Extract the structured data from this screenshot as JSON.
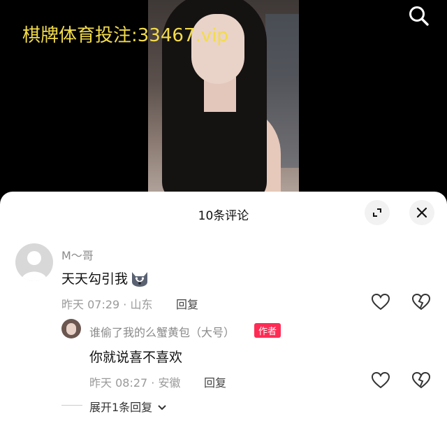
{
  "overlay": {
    "watermark": "棋牌体育投注:33467.vip"
  },
  "sheet": {
    "title": "10条评论"
  },
  "comment": {
    "username": "M～哥",
    "text": "天天勾引我",
    "time": "昨天 07:29 · 山东",
    "reply_label": "回复"
  },
  "reply": {
    "username": "谁偷了我的么蟹黄包（大号）",
    "badge": "作者",
    "text": "你就说喜不喜欢",
    "time": "昨天 08:27 · 安徽",
    "reply_label": "回复"
  },
  "expand_label": "展开1条回复",
  "colors": {
    "badge": "#fe2c55",
    "watermark": "#f3dc4a"
  }
}
